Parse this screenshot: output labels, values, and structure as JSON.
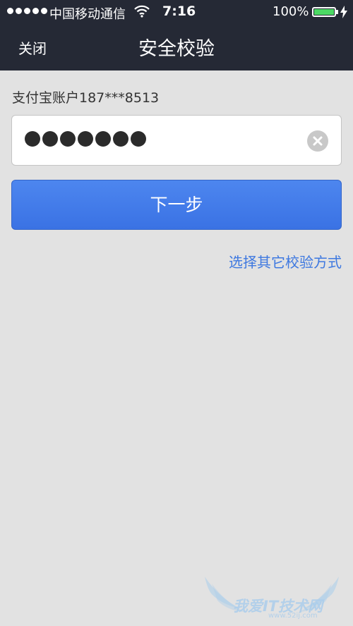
{
  "status_bar": {
    "carrier": "中国移动通信",
    "time": "7:16",
    "battery": "100%"
  },
  "nav": {
    "close_label": "关闭",
    "title": "安全校验"
  },
  "form": {
    "account_label": "支付宝账户187***8513",
    "password_masked_count": 7,
    "next_button": "下一步",
    "other_method_link": "选择其它校验方式"
  },
  "watermark": {
    "text": "我爱IT技术网",
    "url": "www.52ij.com"
  },
  "colors": {
    "header_bg": "#252935",
    "page_bg": "#e2e2e2",
    "primary_button": "#3f7be9",
    "link": "#3d78e0"
  }
}
